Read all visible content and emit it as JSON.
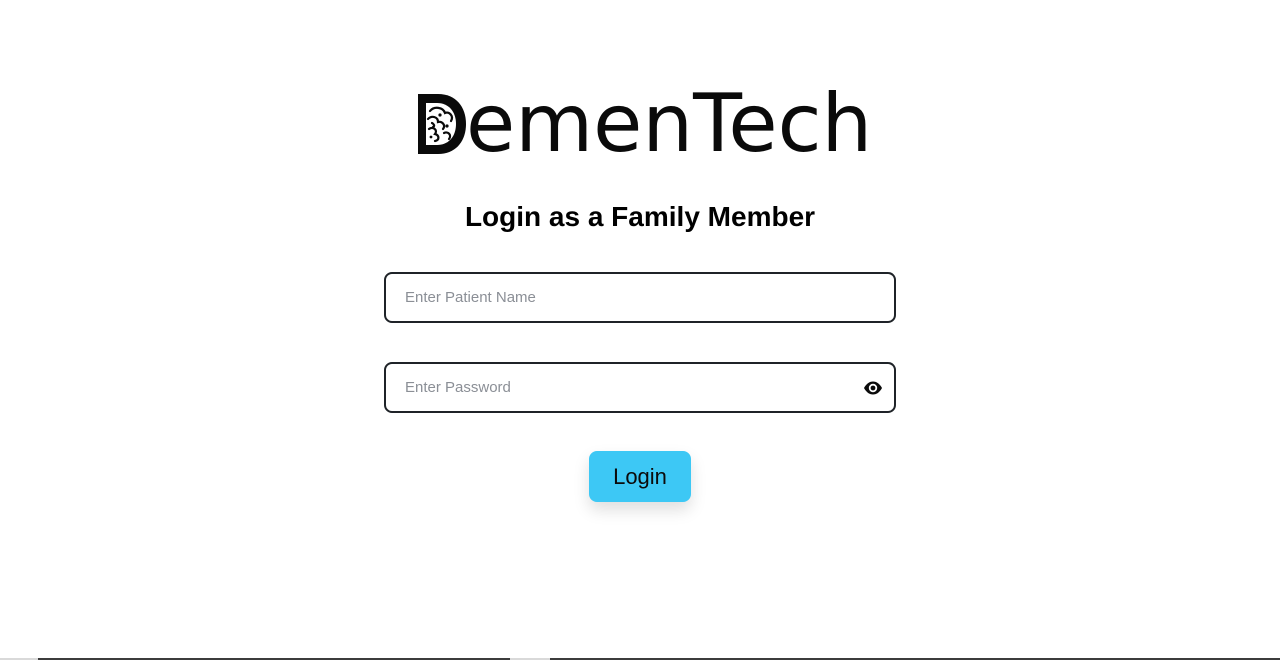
{
  "logo": {
    "text": "emenTech",
    "full_text": "DemenTech"
  },
  "heading": "Login as a Family Member",
  "form": {
    "patient_name": {
      "placeholder": "Enter Patient Name",
      "value": ""
    },
    "password": {
      "placeholder": "Enter Password",
      "value": "",
      "toggle_icon": "eye-icon"
    },
    "login_label": "Login"
  },
  "colors": {
    "accent": "#3dc8f5",
    "border": "#1f2328",
    "placeholder": "#8b8f96"
  }
}
